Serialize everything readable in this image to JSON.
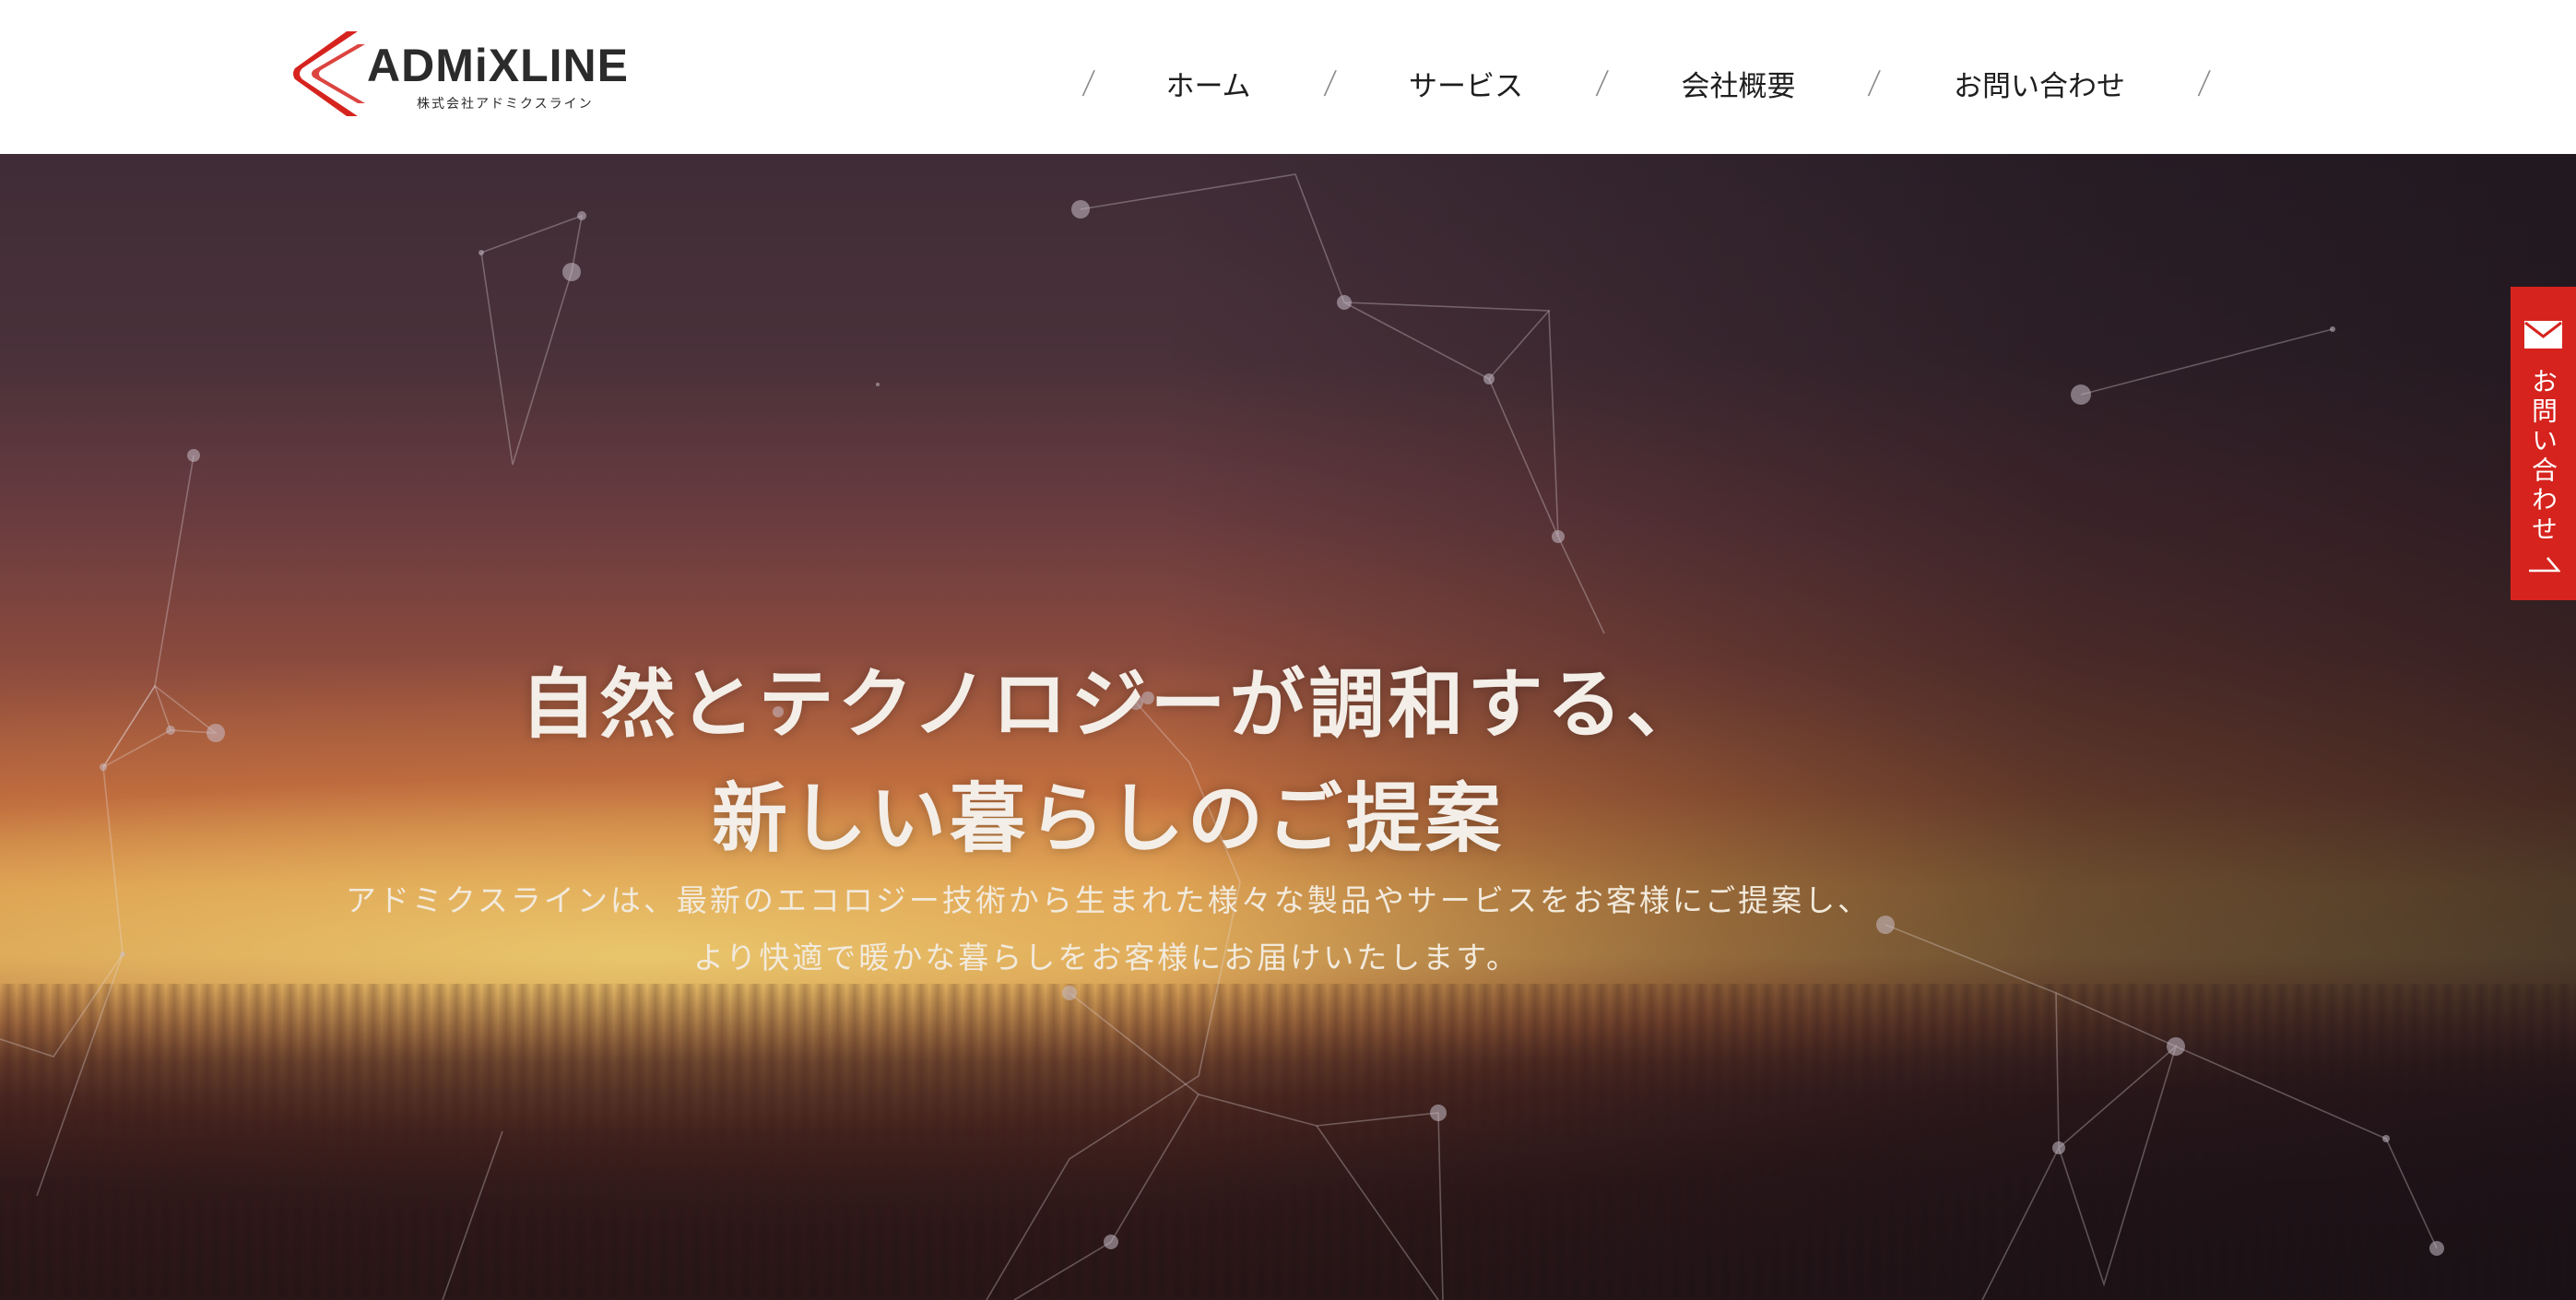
{
  "header": {
    "logo_text": "ADMiXLINE",
    "logo_subtext": "株式会社アドミクスライン",
    "nav": {
      "separator": "/",
      "items": [
        {
          "label": "ホーム"
        },
        {
          "label": "サービス"
        },
        {
          "label": "会社概要"
        },
        {
          "label": "お問い合わせ"
        }
      ]
    }
  },
  "hero": {
    "title_line1": "自然とテクノロジーが調和する、",
    "title_line2": "新しい暮らしのご提案",
    "lead_line1": "アドミクスラインは、最新のエコロジー技術から生まれた様々な製品やサービスをお客様にご提案し、",
    "lead_line2": "より快適で暖かな暮らしをお客様にお届けいたします。"
  },
  "side_contact": {
    "label": "お問い合わせ",
    "icon": "mail-icon",
    "arrow_icon": "arrow-icon"
  },
  "colors": {
    "brand_red": "#d6231e",
    "header_bg": "#ffffff",
    "nav_text": "#1e1e1e",
    "hero_text": "#f4eee8"
  }
}
